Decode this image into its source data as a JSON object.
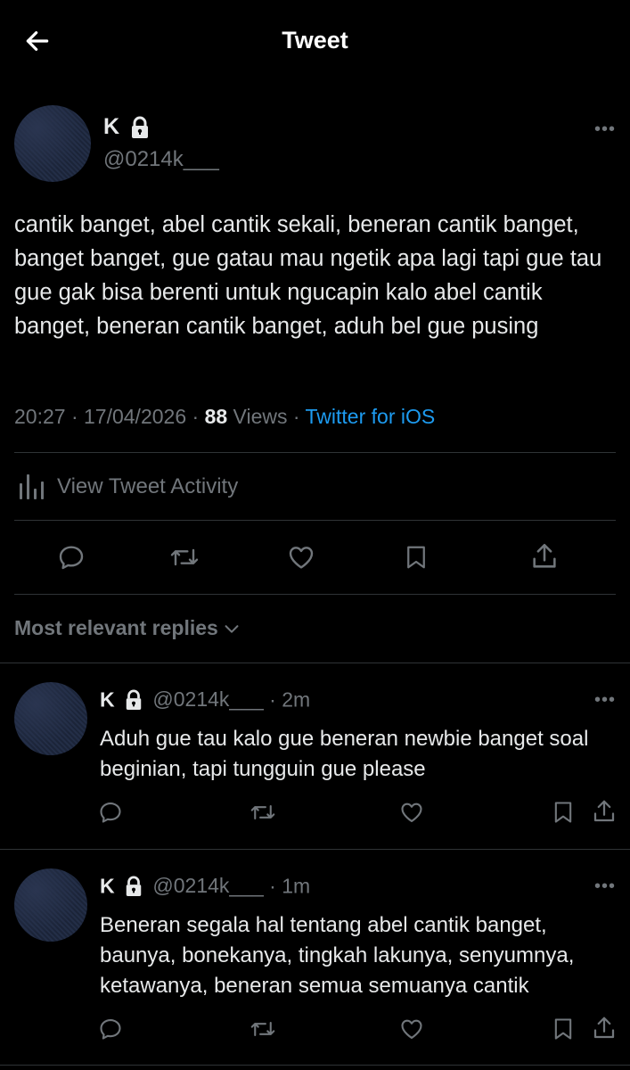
{
  "header": {
    "title": "Tweet"
  },
  "tweet": {
    "name": "K",
    "handle": "@0214k___",
    "text": "cantik banget, abel cantik sekali, beneran cantik banget, banget banget, gue gatau mau ngetik apa lagi tapi gue tau gue gak bisa berenti untuk ngucapin kalo abel cantik banget, beneran cantik banget, aduh bel gue pusing",
    "time": "20:27 · 17/04/2026 · ",
    "views_count": "88",
    "views_label": " Views",
    "sep": " · ",
    "source": "Twitter for iOS"
  },
  "activity": {
    "label": "View Tweet Activity"
  },
  "replies_header": {
    "label": "Most relevant replies"
  },
  "replies": [
    {
      "name": "K",
      "handle": "@0214k___",
      "time": " · 2m",
      "text": "Aduh gue tau kalo gue beneran newbie banget soal beginian, tapi tungguin gue please"
    },
    {
      "name": "K",
      "handle": "@0214k___",
      "time": " · 1m",
      "text": "Beneran segala hal tentang abel cantik banget, baunya, bonekanya, tingkah lakunya, senyumnya, ketawanya, beneran semua semuanya cantik"
    }
  ],
  "colors": {
    "accent": "#1d9bf0",
    "dim": "#71767b",
    "background": "#000000"
  },
  "icons": [
    "back-arrow-icon",
    "lock-icon",
    "more-icon",
    "chart-icon",
    "reply-icon",
    "retweet-icon",
    "like-icon",
    "bookmark-icon",
    "share-icon",
    "chevron-down-icon"
  ]
}
